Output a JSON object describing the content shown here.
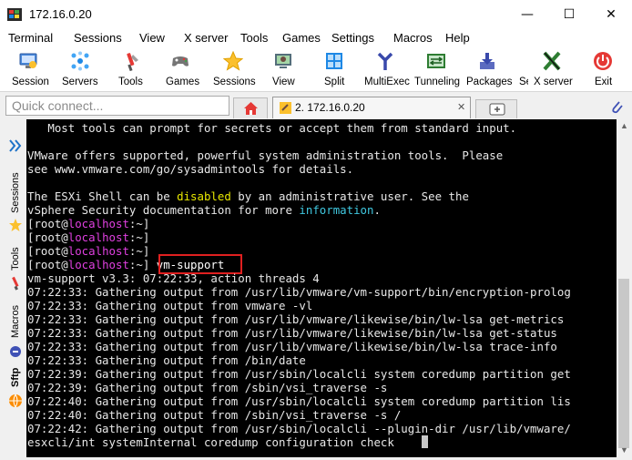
{
  "window": {
    "title": "172.16.0.20",
    "minimize": "—",
    "maximize": "☐",
    "close": "✕"
  },
  "menu": [
    "Terminal",
    "Sessions",
    "View",
    "X server",
    "Tools",
    "Games",
    "Settings",
    "Macros",
    "Help"
  ],
  "toolbar": [
    {
      "label": "Session",
      "icon": "session-icon"
    },
    {
      "label": "Servers",
      "icon": "servers-icon"
    },
    {
      "label": "Tools",
      "icon": "tools-icon"
    },
    {
      "label": "Games",
      "icon": "games-icon"
    },
    {
      "label": "Sessions",
      "icon": "star-icon"
    },
    {
      "label": "View",
      "icon": "view-icon"
    },
    {
      "label": "Split",
      "icon": "split-icon"
    },
    {
      "label": "MultiExec",
      "icon": "multiexec-icon"
    },
    {
      "label": "Tunneling",
      "icon": "tunneling-icon"
    },
    {
      "label": "Packages",
      "icon": "packages-icon"
    },
    {
      "label": "Se",
      "icon": "settings-icon"
    },
    {
      "label": "X server",
      "icon": "xserver-icon"
    },
    {
      "label": "Exit",
      "icon": "exit-icon"
    }
  ],
  "quick_connect": {
    "placeholder": "Quick connect..."
  },
  "session_tab": {
    "label": "2. 172.16.0.20"
  },
  "sidebar": {
    "sessions": "Sessions",
    "tools": "Tools",
    "macros": "Macros",
    "sftp": "Sftp"
  },
  "colors": {
    "hostname": "#e040e0",
    "highlight": "#e8e800",
    "link": "#40c8e0",
    "box": "#e02020"
  },
  "terminal": {
    "lines": [
      "   Most tools can prompt for secrets or accept them from standard input.",
      "",
      "VMware offers supported, powerful system administration tools.  Please",
      "see www.vmware.com/go/sysadmintools for details.",
      "",
      "The ESXi Shell can be disabled by an administrative user. See the",
      "vSphere Security documentation for more information.",
      "[root@localhost:~]",
      "[root@localhost:~]",
      "[root@localhost:~]",
      "[root@localhost:~] vm-support",
      "vm-support v3.3: 07:22:33, action threads 4",
      "07:22:33: Gathering output from /usr/lib/vmware/vm-support/bin/encryption-prolog",
      "07:22:33: Gathering output from vmware -vl",
      "07:22:33: Gathering output from /usr/lib/vmware/likewise/bin/lw-lsa get-metrics",
      "07:22:33: Gathering output from /usr/lib/vmware/likewise/bin/lw-lsa get-status",
      "07:22:33: Gathering output from /usr/lib/vmware/likewise/bin/lw-lsa trace-info",
      "07:22:33: Gathering output from /bin/date",
      "07:22:39: Gathering output from /usr/sbin/localcli system coredump partition get",
      "07:22:39: Gathering output from /sbin/vsi_traverse -s",
      "07:22:40: Gathering output from /usr/sbin/localcli system coredump partition lis",
      "07:22:40: Gathering output from /sbin/vsi_traverse -s /",
      "07:22:42: Gathering output from /usr/sbin/localcli --plugin-dir /usr/lib/vmware/",
      "esxcli/int systemInternal coredump configuration check"
    ]
  }
}
